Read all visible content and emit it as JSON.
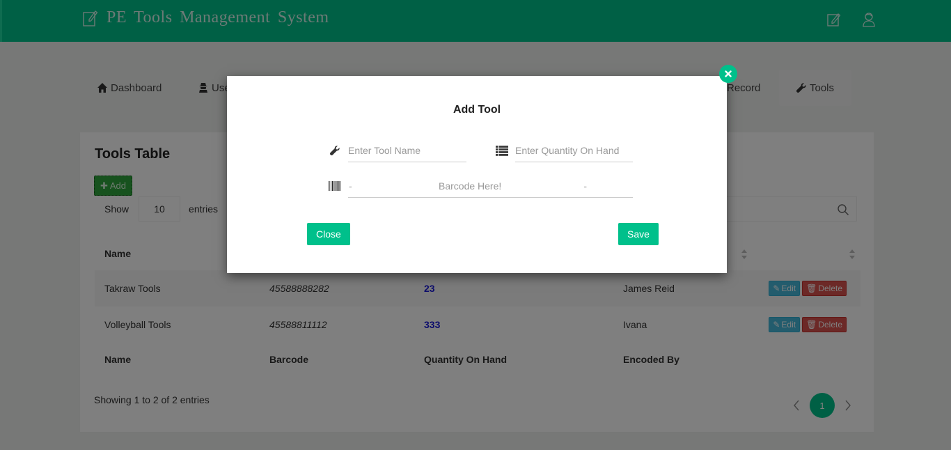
{
  "app": {
    "title": "PE Tools Management System",
    "header_icons": [
      "edit-icon",
      "user-icon"
    ]
  },
  "nav": {
    "items": [
      {
        "label": "Dashboard",
        "icon": "home-icon",
        "active": false
      },
      {
        "label": "Users",
        "icon": "user-secret-icon",
        "active": false
      },
      {
        "label": "Record",
        "icon": "",
        "active": false
      },
      {
        "label": "Tools",
        "icon": "wrench-icon",
        "active": true
      }
    ]
  },
  "panel": {
    "title": "Tools Table",
    "add_label": "Add",
    "show_label": "Show",
    "entries_label": "entries",
    "page_length": "10",
    "search_value": "",
    "columns": [
      "Name",
      "Barcode",
      "Quantity On Hand",
      "Encoded By",
      ""
    ],
    "rows": [
      {
        "name": "Takraw Tools",
        "barcode": "45588888282",
        "qty": "23",
        "encoded_by": "James Reid"
      },
      {
        "name": "Volleyball Tools",
        "barcode": "45588811112",
        "qty": "333",
        "encoded_by": "Ivana"
      }
    ],
    "row_actions": {
      "edit": "Edit",
      "delete": "Delete"
    },
    "info": "Showing 1 to 2 of 2 entries",
    "pagination": {
      "current": "1",
      "prev": "‹",
      "next": "›"
    }
  },
  "modal": {
    "title": "Add Tool",
    "tool_name_placeholder": "Enter Tool Name",
    "tool_name_value": "",
    "quantity_placeholder": "Enter Quantity On Hand",
    "quantity_value": "",
    "barcode_left": "-",
    "barcode_placeholder": "Barcode Here!",
    "barcode_right": "-",
    "close_label": "Close",
    "save_label": "Save"
  },
  "colors": {
    "brand": "#00c08b",
    "add_button": "#2fa43c",
    "edit_button": "#46b8da",
    "delete_button": "#d9534f",
    "quantity_text": "#1a1ad8"
  }
}
